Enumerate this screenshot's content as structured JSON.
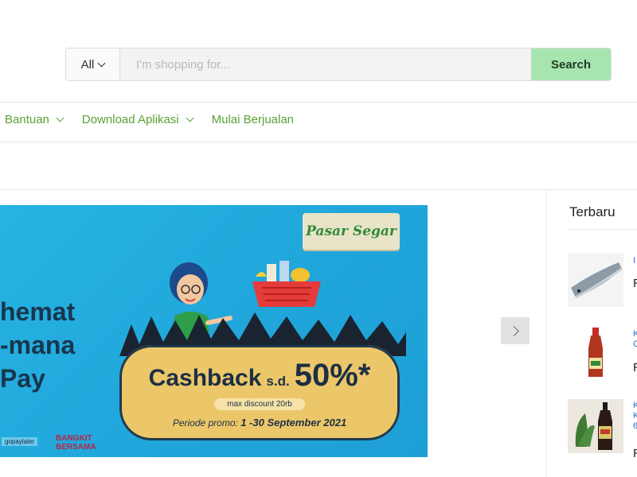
{
  "search": {
    "category": "All",
    "placeholder": "I'm shopping for...",
    "value": "",
    "button_label": "Search"
  },
  "nav": {
    "items": [
      {
        "label": "Bantuan",
        "has_dropdown": true
      },
      {
        "label": "Download Aplikasi",
        "has_dropdown": true
      },
      {
        "label": "Mulai Berjualan",
        "has_dropdown": false
      }
    ]
  },
  "banner": {
    "left_text": [
      "hemat",
      "-mana",
      "Pay"
    ],
    "brand": "Pasar Segar",
    "cashback_word": "Cashback",
    "cashback_sd": "s.d.",
    "cashback_pct": "50%*",
    "max_discount": "max discount 20rb",
    "period_label": "Periode promo:",
    "period_value": "1 -30 September 2021",
    "logo1": "gopaylater",
    "logo2_line1": "BANGKIT",
    "logo2_line2": "BERSAMA"
  },
  "sidebar": {
    "title": "Terbaru",
    "products": [
      {
        "link_lines": [
          "I"
        ],
        "price": "R"
      },
      {
        "link_lines": [
          "K",
          "C"
        ],
        "price": "R"
      },
      {
        "link_lines": [
          "K",
          "K",
          "6"
        ],
        "price": "R"
      }
    ]
  },
  "colors": {
    "accent_green": "#5aa134",
    "search_button": "#a8e4b0",
    "banner_bg": "#22a9de",
    "link_blue": "#2a6fd1"
  }
}
